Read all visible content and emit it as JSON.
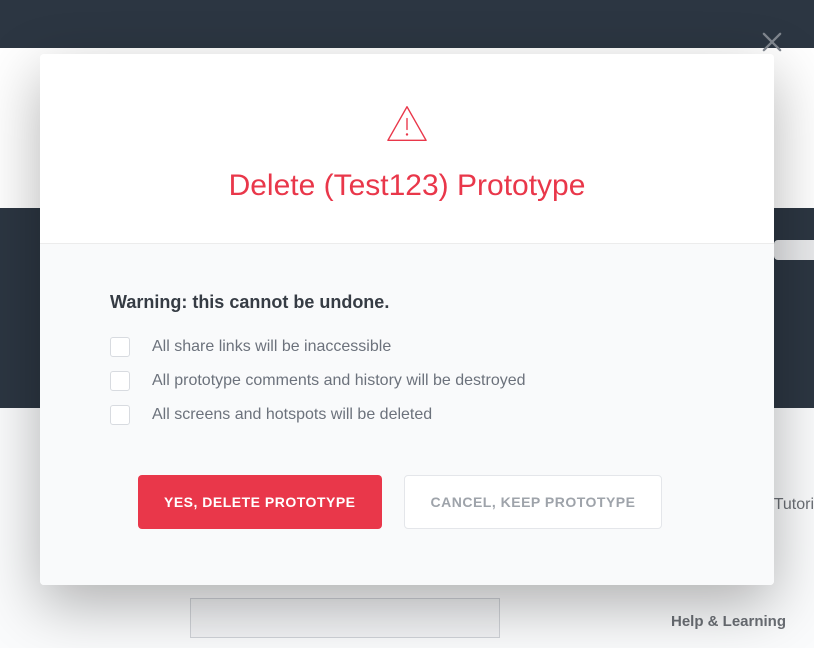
{
  "modal": {
    "title": "Delete (Test123) Prototype",
    "warning": "Warning: this cannot be undone.",
    "checks": [
      "All share links will be inaccessible",
      "All prototype comments and history will be destroyed",
      "All screens and hotspots will be deleted"
    ],
    "confirmLabel": "YES, DELETE PROTOTYPE",
    "cancelLabel": "CANCEL, KEEP PROTOTYPE"
  },
  "background": {
    "help": "Help & Learning",
    "tutor": "Tutori"
  },
  "colors": {
    "danger": "#e9374a",
    "darkbg": "#2c3642"
  }
}
